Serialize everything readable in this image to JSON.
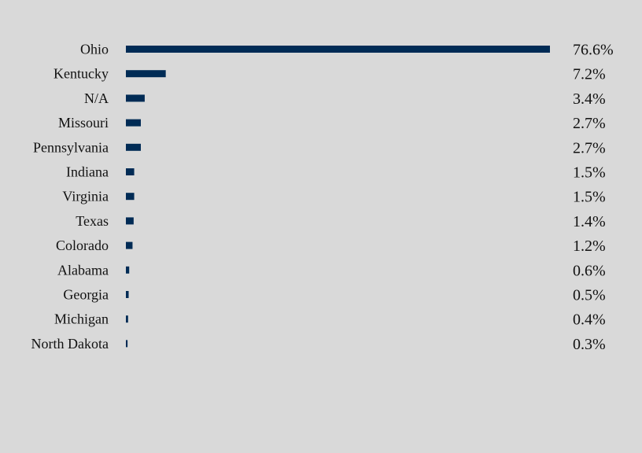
{
  "chart_data": {
    "type": "bar",
    "orientation": "horizontal",
    "title": "",
    "xlabel": "",
    "ylabel": "",
    "categories": [
      "Ohio",
      "Kentucky",
      "N/A",
      "Missouri",
      "Pennsylvania",
      "Indiana",
      "Virginia",
      "Texas",
      "Colorado",
      "Alabama",
      "Georgia",
      "Michigan",
      "North Dakota"
    ],
    "values": [
      76.6,
      7.2,
      3.4,
      2.7,
      2.7,
      1.5,
      1.5,
      1.4,
      1.2,
      0.6,
      0.5,
      0.4,
      0.3
    ],
    "value_labels": [
      "76.6%",
      "7.2%",
      "3.4%",
      "2.7%",
      "2.7%",
      "1.5%",
      "1.5%",
      "1.4%",
      "1.2%",
      "0.6%",
      "0.5%",
      "0.4%",
      "0.3%"
    ],
    "unit": "%",
    "xlim": [
      0,
      76.6
    ],
    "grid": false,
    "legend": "none",
    "bar_color": "#002b55",
    "background_color": "#d9d9d9"
  }
}
